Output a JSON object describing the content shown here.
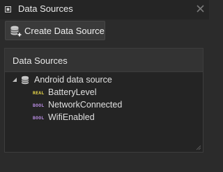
{
  "window": {
    "title": "Data Sources",
    "icons": {
      "pin": "pin-icon",
      "close": "close-icon"
    }
  },
  "toolbar": {
    "create_label": "Create Data Source",
    "create_icon": "database-add-icon"
  },
  "panel": {
    "header": "Data Sources",
    "tree": {
      "root": {
        "label": "Android data source",
        "icon": "database-icon",
        "expanded": true
      },
      "children": [
        {
          "type": "REAL",
          "label": "BatteryLevel",
          "type_color": "#e8d64a"
        },
        {
          "type": "BOOL",
          "label": "NetworkConnected",
          "type_color": "#b78be0"
        },
        {
          "type": "BOOL",
          "label": "WifiEnabled",
          "type_color": "#b78be0"
        }
      ]
    }
  },
  "colors": {
    "background": "#2b2b2b",
    "titlebar": "#252525",
    "panel": "#242424",
    "panel_header": "#333333"
  }
}
